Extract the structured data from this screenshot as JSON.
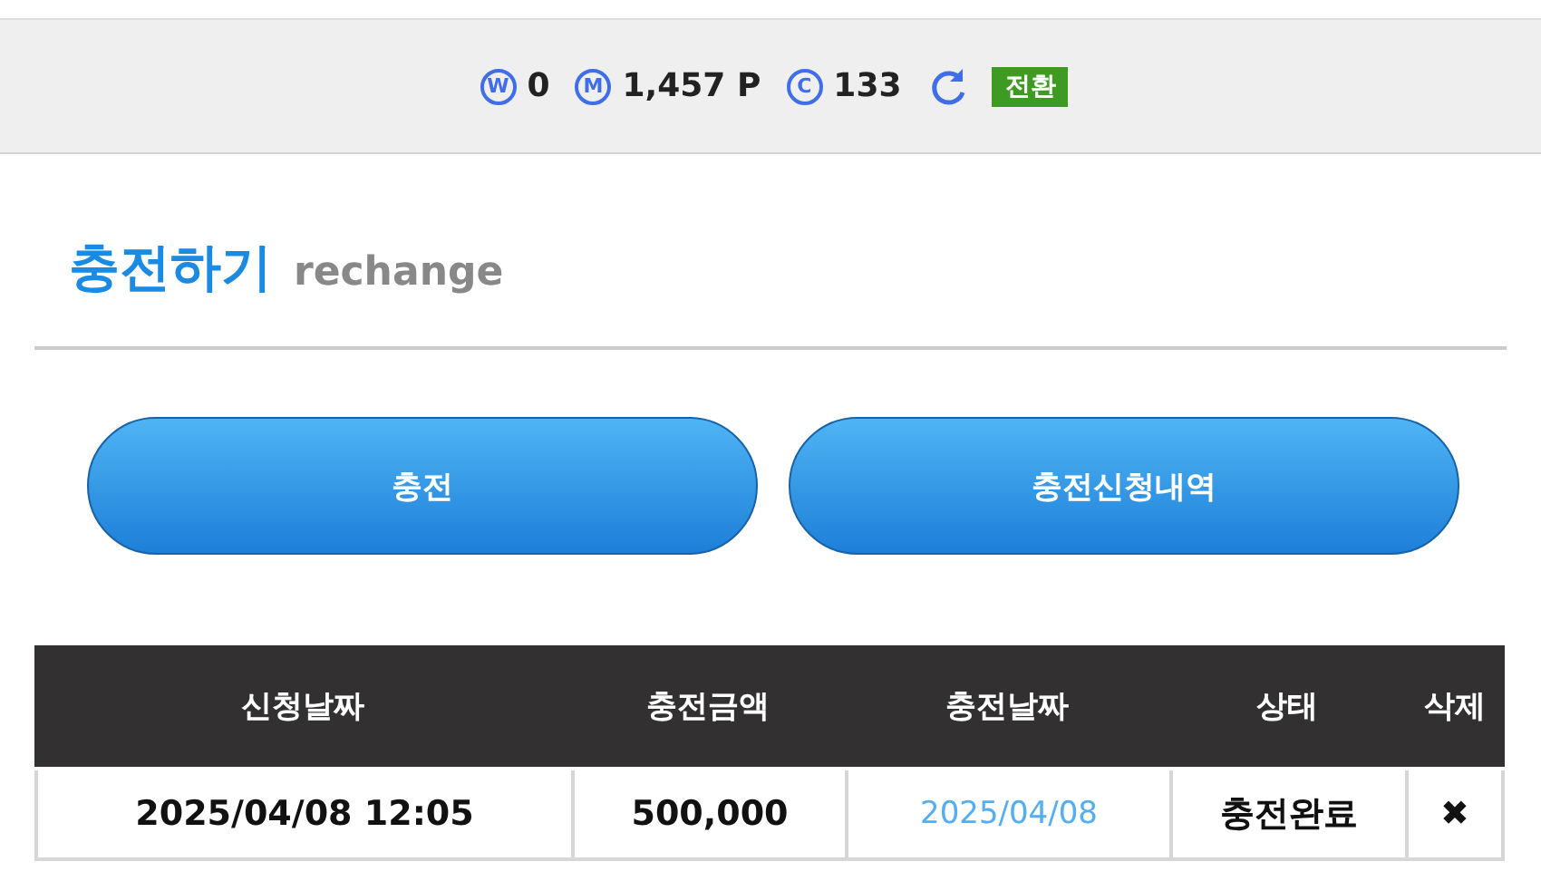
{
  "balances": [
    {
      "icon": "W",
      "value": "0"
    },
    {
      "icon": "M",
      "value": "1,457 P"
    },
    {
      "icon": "C",
      "value": "133"
    }
  ],
  "switch_button": "전환",
  "title": "충전하기",
  "subtitle": "rechange",
  "buttons": [
    "충전",
    "충전신청내역"
  ],
  "table": {
    "columns": [
      "신청날짜",
      "충전금액",
      "충전날짜",
      "상태",
      "삭제"
    ],
    "rows": [
      {
        "requested": "2025/04/08 12:05",
        "amount": "500,000",
        "charged": "2025/04/08",
        "status": "충전완료",
        "delete": "✖"
      }
    ]
  }
}
